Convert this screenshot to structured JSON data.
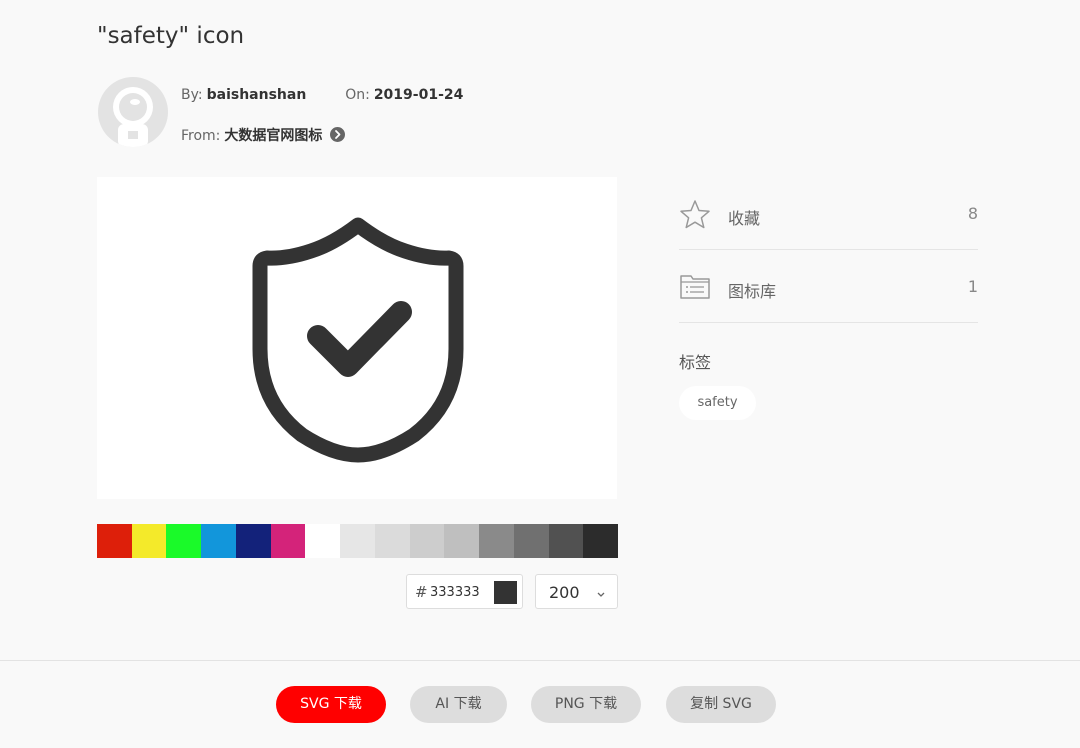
{
  "title": "\"safety\" icon",
  "meta": {
    "by_label": "By:",
    "author": "baishanshan",
    "on_label": "On:",
    "date": "2019-01-24",
    "from_label": "From:",
    "source": "大数据官网图标"
  },
  "palette": [
    "#dd1f0a",
    "#f4ea2a",
    "#1afa29",
    "#1296db",
    "#13227a",
    "#d4237a",
    "#ffffff",
    "#e6e6e6",
    "#dbdbdb",
    "#cdcdcd",
    "#bfbfbf",
    "#8a8a8a",
    "#707070",
    "#515151",
    "#2c2c2c"
  ],
  "color_input": {
    "hash": "#",
    "value": "333333",
    "current_color": "#333333"
  },
  "size_select": {
    "value": "200"
  },
  "sidebar": {
    "favorite": {
      "label": "收藏",
      "count": "8"
    },
    "library": {
      "label": "图标库",
      "count": "1"
    },
    "tags_heading": "标签",
    "tags": [
      "safety"
    ]
  },
  "actions": {
    "svg_download": "SVG 下载",
    "ai_download": "AI 下载",
    "png_download": "PNG 下载",
    "copy_svg": "复制 SVG"
  },
  "colors": {
    "accent": "#ff0000",
    "icon": "#333333"
  }
}
